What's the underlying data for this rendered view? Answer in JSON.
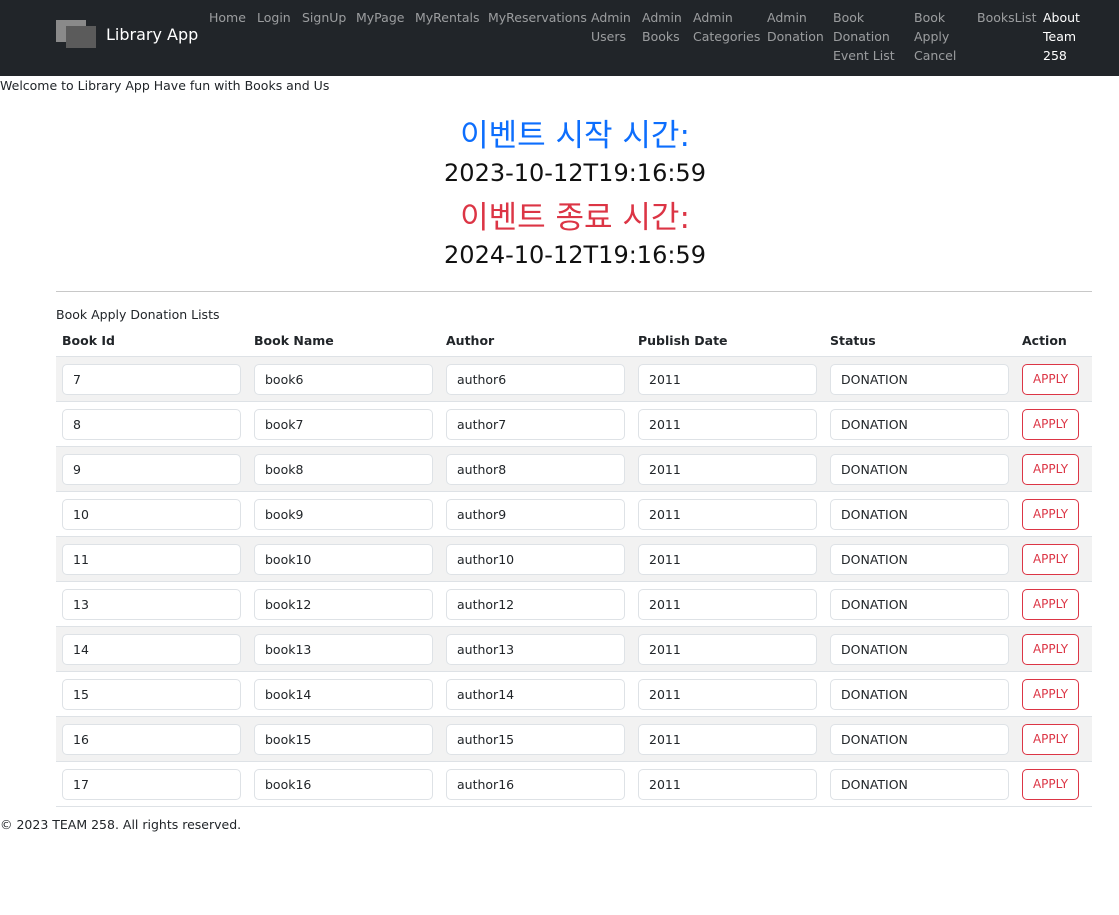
{
  "navbar": {
    "brand": "Library App",
    "items": [
      {
        "label": "Home",
        "active": true
      },
      {
        "label": "Login",
        "active": false
      },
      {
        "label": "SignUp",
        "active": false
      },
      {
        "label": "MyPage",
        "active": false
      },
      {
        "label": "MyRentals",
        "active": false
      },
      {
        "label": "MyReservations",
        "active": false
      },
      {
        "label": "Admin\nUsers",
        "active": false
      },
      {
        "label": "Admin\nBooks",
        "active": false
      },
      {
        "label": "Admin\nCategories",
        "active": false
      },
      {
        "label": "Admin\nDonation",
        "active": false
      },
      {
        "label": "Book\nDonation\nEvent List",
        "active": false
      },
      {
        "label": "Book\nApply\nCancel",
        "active": false
      },
      {
        "label": "BooksList",
        "active": false
      },
      {
        "label": "About\nTeam\n258",
        "active": true
      }
    ]
  },
  "welcome": "Welcome to Library App Have fun with Books and Us",
  "event": {
    "start_label": "이벤트 시작 시간:",
    "start_time": "2023-10-12T19:16:59",
    "end_label": "이벤트 종료 시간:",
    "end_time": "2024-10-12T19:16:59"
  },
  "table": {
    "caption": "Book Apply Donation Lists",
    "headers": [
      "Book Id",
      "Book Name",
      "Author",
      "Publish Date",
      "Status",
      "Action"
    ],
    "action_label": "APPLY",
    "rows": [
      {
        "id": "7",
        "name": "book6",
        "author": "author6",
        "date": "2011",
        "status": "DONATION"
      },
      {
        "id": "8",
        "name": "book7",
        "author": "author7",
        "date": "2011",
        "status": "DONATION"
      },
      {
        "id": "9",
        "name": "book8",
        "author": "author8",
        "date": "2011",
        "status": "DONATION"
      },
      {
        "id": "10",
        "name": "book9",
        "author": "author9",
        "date": "2011",
        "status": "DONATION"
      },
      {
        "id": "11",
        "name": "book10",
        "author": "author10",
        "date": "2011",
        "status": "DONATION"
      },
      {
        "id": "13",
        "name": "book12",
        "author": "author12",
        "date": "2011",
        "status": "DONATION"
      },
      {
        "id": "14",
        "name": "book13",
        "author": "author13",
        "date": "2011",
        "status": "DONATION"
      },
      {
        "id": "15",
        "name": "book14",
        "author": "author14",
        "date": "2011",
        "status": "DONATION"
      },
      {
        "id": "16",
        "name": "book15",
        "author": "author15",
        "date": "2011",
        "status": "DONATION"
      },
      {
        "id": "17",
        "name": "book16",
        "author": "author16",
        "date": "2011",
        "status": "DONATION"
      }
    ]
  },
  "footer": "© 2023 TEAM 258. All rights reserved.",
  "colors": {
    "navbar_bg": "#212529",
    "start_label": "#0d6efd",
    "end_label": "#dc3545",
    "apply_button": "#dc3545",
    "striped_row": "#f2f2f2"
  }
}
